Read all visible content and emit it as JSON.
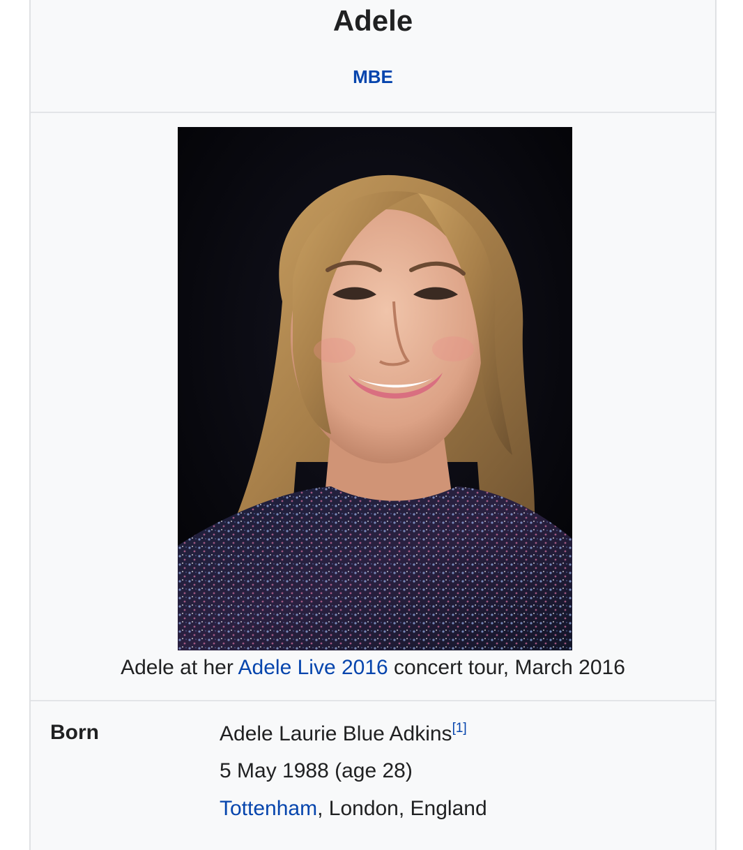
{
  "infobox": {
    "title": "Adele",
    "honorific": "MBE",
    "image": {
      "subject": "portrait photo of Adele smiling, sequinned top, dark background"
    },
    "caption": {
      "prefix": "Adele at her ",
      "link": "Adele Live 2016",
      "suffix": " concert tour, March 2016"
    },
    "born": {
      "label": "Born",
      "name": "Adele Laurie Blue Adkins",
      "ref": "[1]",
      "date": "5 May 1988 (age 28)",
      "place_link": "Tottenham",
      "place_rest": ", London, England"
    },
    "colors": {
      "link": "#0645ad",
      "text": "#202122",
      "background": "#f8f9fa",
      "border": "#dfe1e4"
    }
  }
}
